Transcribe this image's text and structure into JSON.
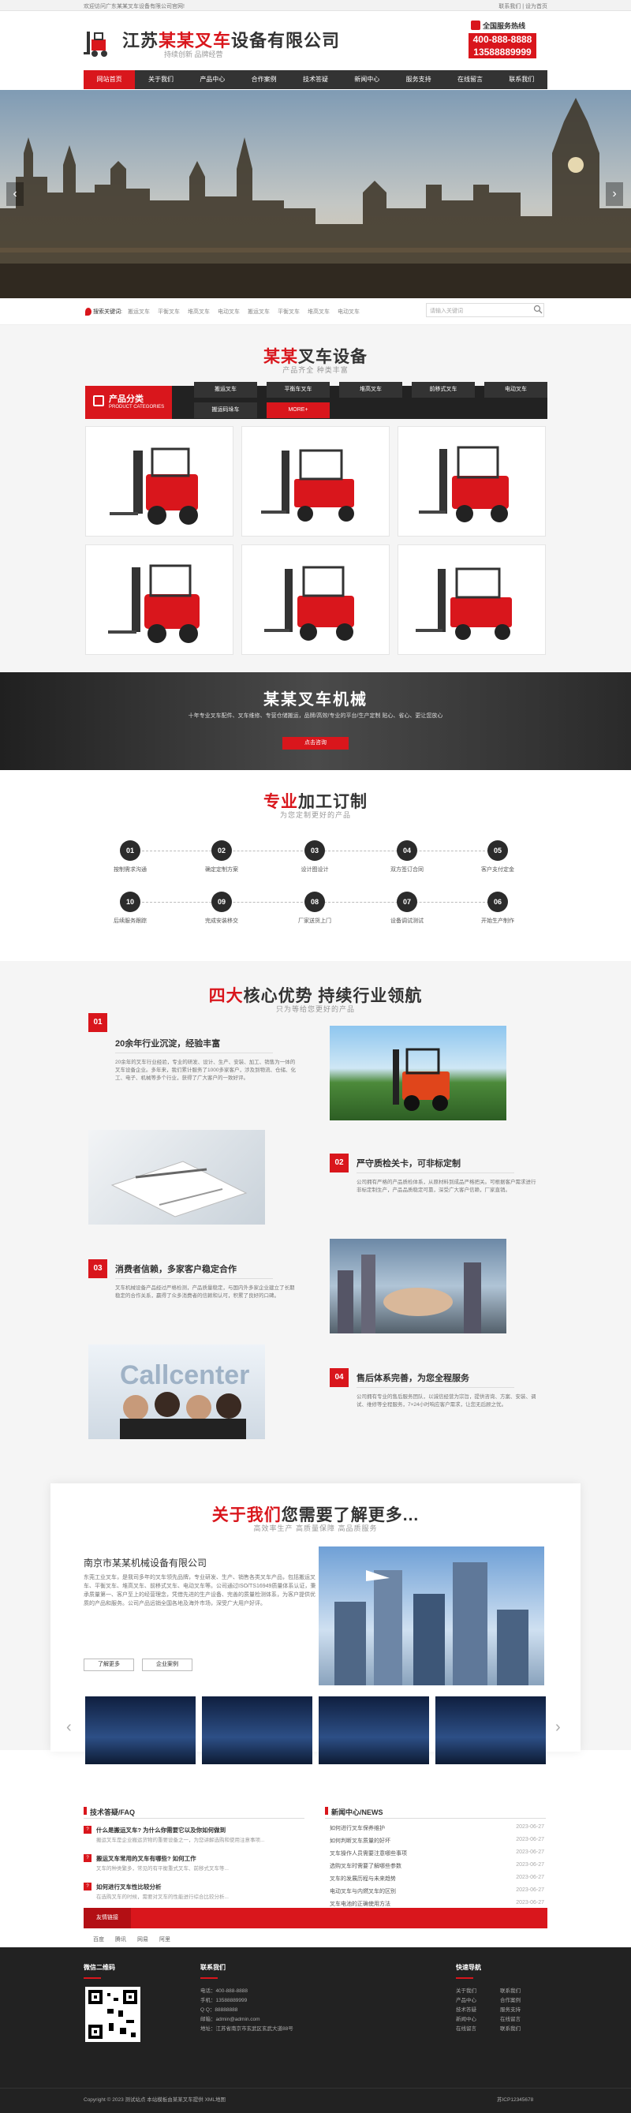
{
  "topbar": {
    "welcome": "欢迎访问广东某某叉车设备有限公司官网!",
    "links": "联系我们 | 设为首页"
  },
  "header": {
    "logo_red": "某某叉车",
    "logo_pre": "江苏",
    "logo_post": "设备有限公司",
    "slogan": "持续创新 品牌经营",
    "hotline_label": "全国服务热线",
    "hotline_1": "400-888-8888",
    "hotline_2": "13588889999"
  },
  "nav": [
    "网站首页",
    "关于我们",
    "产品中心",
    "合作案例",
    "技术答疑",
    "新闻中心",
    "服务支持",
    "在线留言",
    "联系我们"
  ],
  "search": {
    "label": "搜索关键词:",
    "keywords": [
      "搬运叉车",
      "平衡叉车",
      "堆高叉车",
      "电动叉车"
    ],
    "placeholder": "请输入关键词"
  },
  "products": {
    "title_red": "某某",
    "title_rest": "叉车设备",
    "subtitle": "产品齐全  种类丰富",
    "cat_title": "产品分类",
    "cat_sub": "PRODUCT CATEGORIES",
    "categories": [
      "搬运叉车",
      "平衡车叉车",
      "堆高叉车",
      "前移式叉车",
      "电动叉车",
      "搬运码垛车",
      "MORE+"
    ]
  },
  "feature": {
    "title": "某某叉车机械",
    "text": "十年专业叉车配件、叉车维修、专营仓储搬运，品牌/高效/专业的平台/生产定制 贴心、省心、更让您放心",
    "btn": "点击咨询"
  },
  "process": {
    "title_red": "专业",
    "title_rest": "加工订制",
    "subtitle": "为您定制更好的产品",
    "steps": [
      {
        "n": "01",
        "label": "按制需求沟通"
      },
      {
        "n": "02",
        "label": "确定定制方案"
      },
      {
        "n": "03",
        "label": "设计图设计"
      },
      {
        "n": "04",
        "label": "双方签订合同"
      },
      {
        "n": "05",
        "label": "客户支付定金"
      },
      {
        "n": "10",
        "label": "后续服务跟踪"
      },
      {
        "n": "09",
        "label": "完成安装移交"
      },
      {
        "n": "08",
        "label": "厂家送货上门"
      },
      {
        "n": "07",
        "label": "设备调试测试"
      },
      {
        "n": "06",
        "label": "开始生产制作"
      }
    ]
  },
  "advantages": {
    "title_red": "四大",
    "title_rest": "核心优势  持续行业领航",
    "subtitle": "只为等给您更好的产品",
    "items": [
      {
        "n": "01",
        "title": "20余年行业沉淀，经验丰富",
        "text": "20余年的叉车行业经验，专业的研发、设计、生产、安装、加工、销售为一体的叉车设备企业。多年来，我们累计服务了1000多家客户，涉及到物流、仓储、化工、电子、机械等多个行业，获得了广大客户的一致好评。"
      },
      {
        "n": "02",
        "title": "严守质检关卡，可非标定制",
        "text": "公司拥有严格的产品质检体系，从原材料到成品严格把关。可根据客户需求进行非标定制生产，产品品质稳定可靠，深受广大客户信赖，厂家直销。"
      },
      {
        "n": "03",
        "title": "消费者信赖，多家客户稳定合作",
        "text": "叉车机械设备产品经过严格检测，产品质量稳定，与国内外多家企业建立了长期稳定的合作关系，赢得了众多消费者的信赖和认可，积累了良好的口碑。"
      },
      {
        "n": "04",
        "title": "售后体系完善，为您全程服务",
        "text": "公司拥有专业的售后服务团队，以诚信经营为宗旨，提供咨询、方案、安装、调试、维修等全程服务，7×24小时响应客户需求，让您无后顾之忧。"
      }
    ]
  },
  "about": {
    "title_red": "关于我们",
    "title_rest": "您需要了解更多...",
    "subtitle": "高效率生产  高质量保障  高品质服务",
    "company": "南京市某某机械设备有限公司",
    "text": "东莞工业叉车，是我司多年的叉车领先品牌，专业研发、生产、销售各类叉车产品，包括搬运叉车、平衡叉车、堆高叉车、前移式叉车、电动叉车等。公司通过ISO/TS16949质量体系认证，秉承质量第一、客户至上的经营理念，凭借先进的生产设备、完善的质量检测体系，为客户提供优质的产品和服务。公司产品远销全国各地及海外市场，深受广大用户好评。",
    "btn1": "了解更多",
    "btn2": "企业案例"
  },
  "news": {
    "faq_title": "技术答疑/FAQ",
    "faq": [
      {
        "q": "什么是搬运叉车? 为什么你需要它以及你如何做到",
        "a": "搬运叉车是企业搬运货物的重要设备之一，为您讲解选购和使用注意事项..."
      },
      {
        "q": "搬运叉车常用的叉车有哪些? 如何工作",
        "a": "叉车的种类繁多，常见的有平衡重式叉车、前移式叉车等..."
      },
      {
        "q": "如何进行叉车性比较分析",
        "a": "在选购叉车的时候，需要对叉车的性能进行综合比较分析..."
      }
    ],
    "news_title": "新闻中心/NEWS",
    "more": "more",
    "items": [
      {
        "t": "如何进行叉车保养维护",
        "d": "2023-06-27"
      },
      {
        "t": "如何判断叉车质量的好坏",
        "d": "2023-06-27"
      },
      {
        "t": "叉车操作人员需要注意哪些事项",
        "d": "2023-06-27"
      },
      {
        "t": "选购叉车时需要了解哪些参数",
        "d": "2023-06-27"
      },
      {
        "t": "叉车的发展历程与未来趋势",
        "d": "2023-06-27"
      },
      {
        "t": "电动叉车与内燃叉车的区别",
        "d": "2023-06-27"
      },
      {
        "t": "叉车电池的正确使用方法",
        "d": "2023-06-27"
      }
    ]
  },
  "links": {
    "label": "友情链接",
    "items": [
      "百度",
      "腾讯",
      "网易",
      "阿里"
    ]
  },
  "footer": {
    "qr_title": "微信二维码",
    "contact_title": "联系我们",
    "contact": [
      "电话：400-888-8888",
      "手机：13588889999",
      "Q Q：88888888",
      "邮箱：admin@admin.com",
      "地址：江苏省南京市玄武区玄武大道88号"
    ],
    "nav_title": "快速导航",
    "nav_col1": [
      "关于我们",
      "产品中心",
      "技术答疑",
      "新闻中心",
      "在线留言"
    ],
    "nav_col2": [
      "联系我们",
      "合作案例",
      "服务支持",
      "在线留言",
      "联系我们"
    ],
    "copyright": "Copyright © 2023 测试站点 本站模板由某某叉车提供 XML地图",
    "icp": "苏ICP12345678"
  },
  "colors": {
    "accent": "#d9161c",
    "dark": "#333333"
  }
}
